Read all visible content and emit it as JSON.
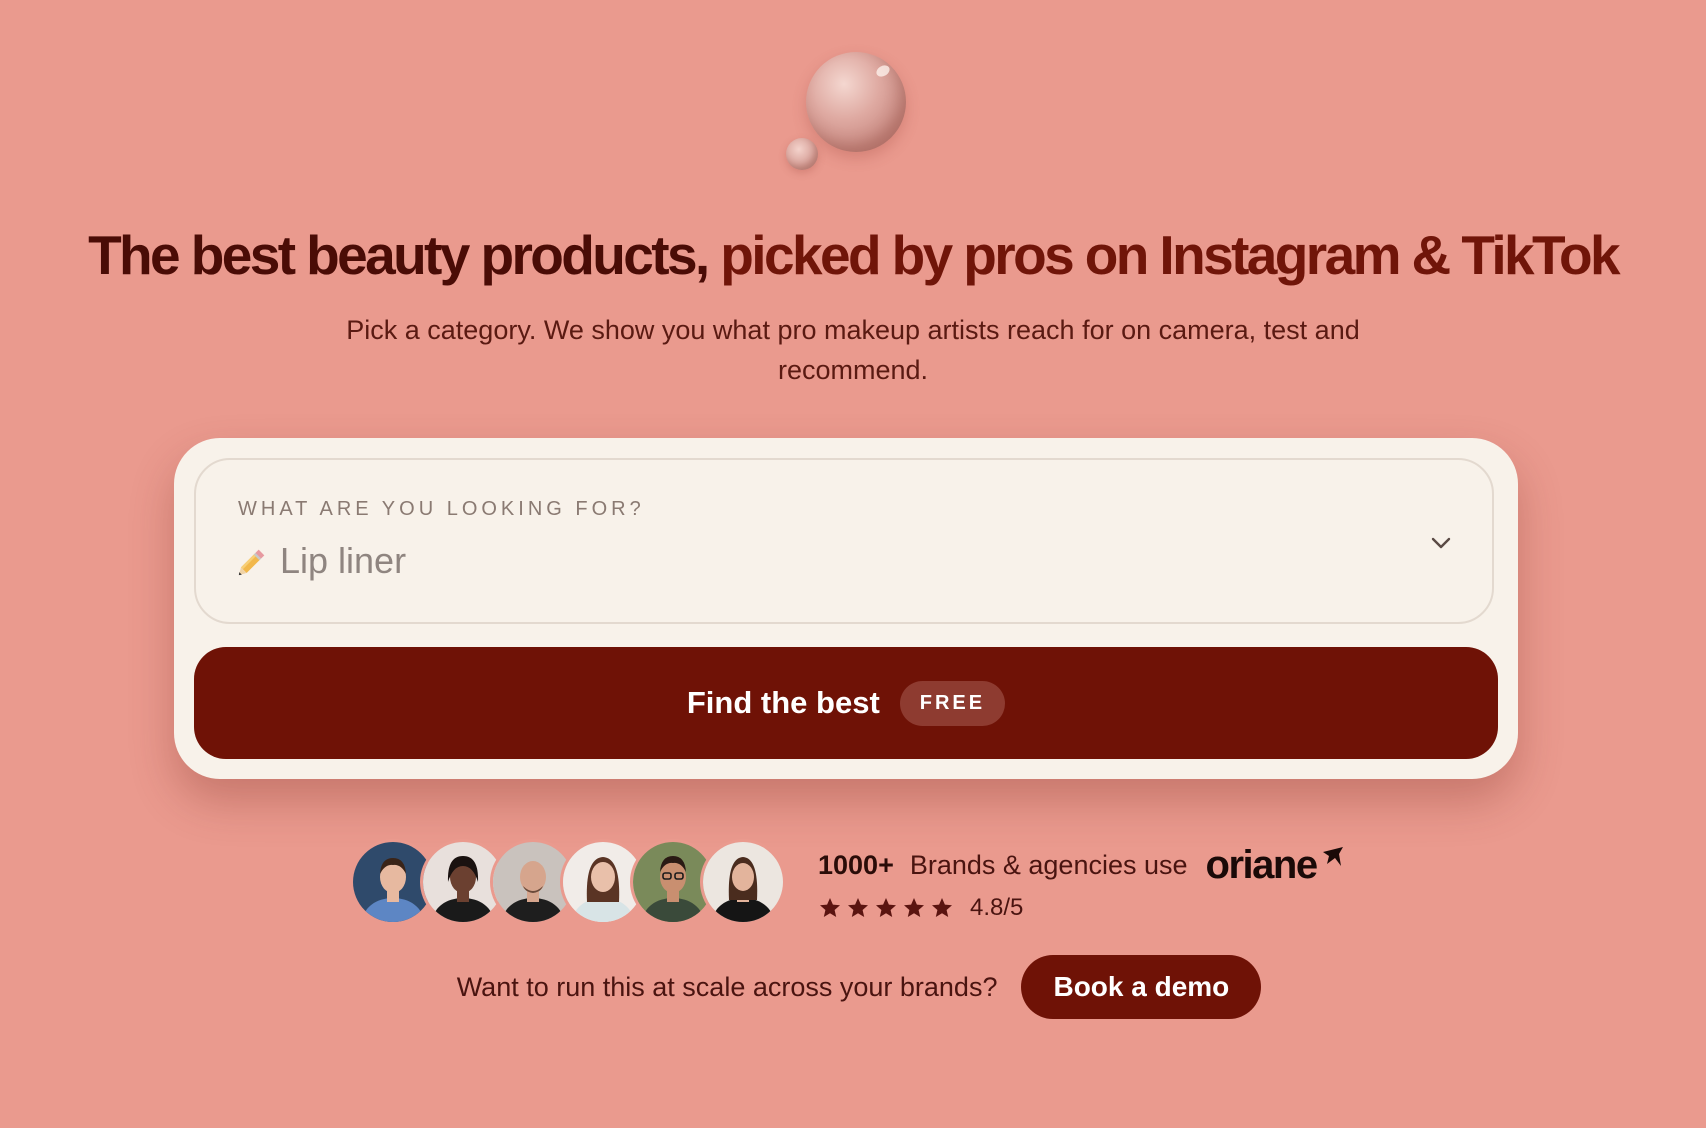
{
  "hero": {
    "headline_part1": "The best beauty products,",
    "headline_part2": "picked by pros on Instagram & TikTok",
    "subtitle": "Pick a category. We show you what pro makeup artists reach for on camera, test and recommend."
  },
  "search": {
    "label": "WHAT ARE YOU LOOKING FOR?",
    "selected_icon": "pencil-icon",
    "selected_value": "Lip liner",
    "button_label": "Find the best",
    "button_badge": "FREE"
  },
  "social_proof": {
    "count": "1000+",
    "text": "Brands & agencies use",
    "brand": "oriane",
    "rating": "4.8/5",
    "stars": 5,
    "avatars": [
      {
        "bg": "#2f4a6b",
        "skin": "#e7b9a0",
        "hair": "#3a2418",
        "shirt": "#5d86c4"
      },
      {
        "bg": "#e8e0dc",
        "skin": "#6b4030",
        "hair": "#1a1210",
        "shirt": "#1a1a1a"
      },
      {
        "bg": "#c9c2bd",
        "skin": "#d6a58d",
        "hair": "#6a4a3a",
        "shirt": "#1e1e1e"
      },
      {
        "bg": "#f1ece8",
        "skin": "#e9c0aa",
        "hair": "#5a3424",
        "shirt": "#d8e4e6"
      },
      {
        "bg": "#7a8a5a",
        "skin": "#c98f70",
        "hair": "#2a1a14",
        "shirt": "#3a4a3a"
      },
      {
        "bg": "#ece6e0",
        "skin": "#e3b49c",
        "hair": "#4a2c1e",
        "shirt": "#151515"
      }
    ]
  },
  "demo": {
    "text": "Want to run this at scale across your brands?",
    "button_label": "Book a demo"
  },
  "colors": {
    "background": "#ea9a8e",
    "primary": "#6f1206",
    "card": "#f8f2ea",
    "heading_dark": "#4a0c06",
    "heading_accent": "#701509"
  }
}
